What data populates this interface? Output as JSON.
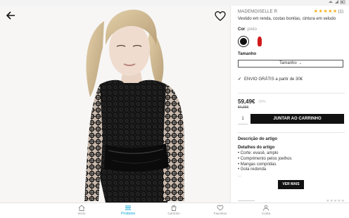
{
  "status_bar": {
    "icons": [
      "wifi-icon",
      "signal-icon",
      "battery-icon"
    ]
  },
  "product": {
    "brand": "MADEMOISELLE R",
    "name": "Vestido em renda, costas bonitas, cintura em veludo",
    "rating": 5,
    "rating_stars": "★★★★★",
    "review_count": "(1)",
    "color_label": "Cor",
    "color_value": "preto",
    "swatches": [
      {
        "name": "black",
        "color": "#111111",
        "selected": true
      },
      {
        "name": "red",
        "color": "#d11a1a",
        "selected": false
      }
    ],
    "size_label": "Tamanho",
    "size_placeholder": "Tamanho",
    "shipping_text": "ENVIO GRÁTIS a partir de 30€",
    "price": "59,49€",
    "old_price": "84,99€",
    "discount": "-30%",
    "quantity": "1",
    "add_to_cart": "JUNTAR AO CARRINHO",
    "description_title": "Descrição do artigo",
    "details_title": "Detalhes do artigo",
    "details": [
      "• Corte: evasê, amplo",
      "• Comprimento pelos joelhos",
      "• Mangas compridas",
      "• Gola redonda"
    ],
    "details_more": "...",
    "more_button": "VER MAIS"
  },
  "tabs": [
    {
      "label": "Início",
      "icon": "home-icon",
      "active": false
    },
    {
      "label": "Produtos",
      "icon": "menu-icon",
      "active": true
    },
    {
      "label": "Carrinho",
      "icon": "cart-icon",
      "active": false
    },
    {
      "label": "Favoritos",
      "icon": "heart-icon",
      "active": false
    },
    {
      "label": "Conta",
      "icon": "user-icon",
      "active": false
    }
  ],
  "colors": {
    "accent": "#0aa2d6",
    "stars": "#f2b21b",
    "button": "#111111"
  }
}
